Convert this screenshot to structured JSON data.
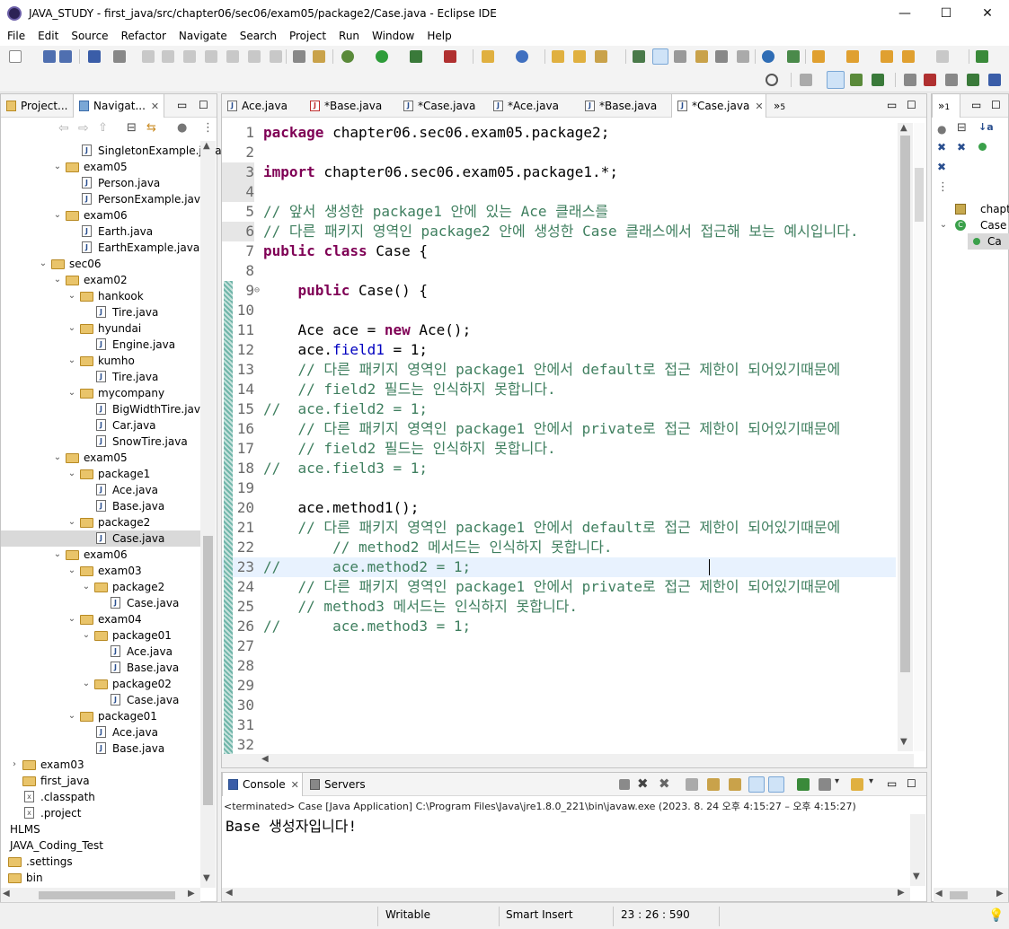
{
  "window": {
    "title": "JAVA_STUDY - first_java/src/chapter06/sec06/exam05/package2/Case.java - Eclipse IDE",
    "minimize": "—",
    "maximize": "☐",
    "close": "✕"
  },
  "menu": [
    "File",
    "Edit",
    "Source",
    "Refactor",
    "Navigate",
    "Search",
    "Project",
    "Run",
    "Window",
    "Help"
  ],
  "left_panel": {
    "tabs": [
      {
        "label": "Project..."
      },
      {
        "label": "Navigat..."
      }
    ],
    "tree": [
      {
        "type": "java",
        "label": "SingletonExample.java",
        "indent": 4
      },
      {
        "type": "folder",
        "label": "exam05",
        "indent": 3,
        "open": true
      },
      {
        "type": "java",
        "label": "Person.java",
        "indent": 4
      },
      {
        "type": "java",
        "label": "PersonExample.java",
        "indent": 4
      },
      {
        "type": "folder",
        "label": "exam06",
        "indent": 3,
        "open": true
      },
      {
        "type": "java",
        "label": "Earth.java",
        "indent": 4
      },
      {
        "type": "java",
        "label": "EarthExample.java",
        "indent": 4
      },
      {
        "type": "folder",
        "label": "sec06",
        "indent": 2,
        "open": true
      },
      {
        "type": "folder",
        "label": "exam02",
        "indent": 3,
        "open": true
      },
      {
        "type": "folder",
        "label": "hankook",
        "indent": 4,
        "open": true
      },
      {
        "type": "java",
        "label": "Tire.java",
        "indent": 5
      },
      {
        "type": "folder",
        "label": "hyundai",
        "indent": 4,
        "open": true
      },
      {
        "type": "java",
        "label": "Engine.java",
        "indent": 5
      },
      {
        "type": "folder",
        "label": "kumho",
        "indent": 4,
        "open": true
      },
      {
        "type": "java",
        "label": "Tire.java",
        "indent": 5
      },
      {
        "type": "folder",
        "label": "mycompany",
        "indent": 4,
        "open": true
      },
      {
        "type": "java",
        "label": "BigWidthTire.java",
        "indent": 5
      },
      {
        "type": "java",
        "label": "Car.java",
        "indent": 5
      },
      {
        "type": "java",
        "label": "SnowTire.java",
        "indent": 5
      },
      {
        "type": "folder",
        "label": "exam05",
        "indent": 3,
        "open": true
      },
      {
        "type": "folder",
        "label": "package1",
        "indent": 4,
        "open": true
      },
      {
        "type": "java",
        "label": "Ace.java",
        "indent": 5
      },
      {
        "type": "java",
        "label": "Base.java",
        "indent": 5
      },
      {
        "type": "folder",
        "label": "package2",
        "indent": 4,
        "open": true
      },
      {
        "type": "java",
        "label": "Case.java",
        "indent": 5,
        "selected": true
      },
      {
        "type": "folder",
        "label": "exam06",
        "indent": 3,
        "open": true
      },
      {
        "type": "folder",
        "label": "exam03",
        "indent": 4,
        "open": true
      },
      {
        "type": "folder",
        "label": "package2",
        "indent": 5,
        "open": true
      },
      {
        "type": "java",
        "label": "Case.java",
        "indent": 6
      },
      {
        "type": "folder",
        "label": "exam04",
        "indent": 4,
        "open": true
      },
      {
        "type": "folder",
        "label": "package01",
        "indent": 5,
        "open": true
      },
      {
        "type": "java",
        "label": "Ace.java",
        "indent": 6
      },
      {
        "type": "java",
        "label": "Base.java",
        "indent": 6
      },
      {
        "type": "folder",
        "label": "package02",
        "indent": 5,
        "open": true
      },
      {
        "type": "java",
        "label": "Case.java",
        "indent": 6
      },
      {
        "type": "folder",
        "label": "package01",
        "indent": 4,
        "open": true
      },
      {
        "type": "java",
        "label": "Ace.java",
        "indent": 5
      },
      {
        "type": "java",
        "label": "Base.java",
        "indent": 5
      },
      {
        "type": "folder",
        "label": "exam03",
        "indent": 0,
        "open": false
      },
      {
        "type": "folder",
        "label": "first_java",
        "indent": 0,
        "open": null
      },
      {
        "type": "xml",
        "label": ".classpath",
        "indent": 0
      },
      {
        "type": "xml",
        "label": ".project",
        "indent": 0
      },
      {
        "type": "project",
        "label": "HLMS",
        "indent": -1
      },
      {
        "type": "project",
        "label": "JAVA_Coding_Test",
        "indent": -1
      },
      {
        "type": "folder",
        "label": ".settings",
        "indent": -1,
        "open": null
      },
      {
        "type": "folder",
        "label": "bin",
        "indent": -1,
        "open": null
      }
    ]
  },
  "editor": {
    "tabs": [
      {
        "label": "Ace.java",
        "active": false,
        "error": false
      },
      {
        "label": "*Base.java",
        "active": false,
        "error": true
      },
      {
        "label": "*Case.java",
        "active": false,
        "error": false
      },
      {
        "label": "*Ace.java",
        "active": false,
        "error": false
      },
      {
        "label": "*Base.java",
        "active": false,
        "error": false
      },
      {
        "label": "*Case.java",
        "active": true,
        "error": false
      }
    ],
    "overflow_count": "5",
    "cursor_line": 23,
    "lines": [
      {
        "n": 1,
        "html": "<span class='kw'>package</span> chapter06.sec06.exam05.package2;"
      },
      {
        "n": 2,
        "html": ""
      },
      {
        "n": 3,
        "html": "<span class='kw'>import</span> chapter06.sec06.exam05.package1.*;"
      },
      {
        "n": 4,
        "html": ""
      },
      {
        "n": 5,
        "html": "<span class='cm'>// 앞서 생성한 package1 안에 있는 Ace 클래스를</span>"
      },
      {
        "n": 6,
        "html": "<span class='cm'>// 다른 패키지 영역인 package2 안에 생성한 Case 클래스에서 접근해 보는 예시입니다.</span>"
      },
      {
        "n": 7,
        "html": "<span class='kw'>public</span> <span class='kw'>class</span> Case {"
      },
      {
        "n": 8,
        "html": ""
      },
      {
        "n": 9,
        "html": "    <span class='kw'>public</span> Case() {"
      },
      {
        "n": 10,
        "html": ""
      },
      {
        "n": 11,
        "html": "    Ace ace = <span class='kw'>new</span> Ace();"
      },
      {
        "n": 12,
        "html": "    ace.<span class='fld'>field1</span> = 1;"
      },
      {
        "n": 13,
        "html": "    <span class='cm'>// 다른 패키지 영역인 package1 안에서 default로 접근 제한이 되어있기때문에</span>"
      },
      {
        "n": 14,
        "html": "    <span class='cm'>// field2 필드는 인식하지 못합니다.</span>"
      },
      {
        "n": 15,
        "html": "<span class='cm'>//  ace.field2 = 1;</span>"
      },
      {
        "n": 16,
        "html": "    <span class='cm'>// 다른 패키지 영역인 package1 안에서 private로 접근 제한이 되어있기때문에</span>"
      },
      {
        "n": 17,
        "html": "    <span class='cm'>// field2 필드는 인식하지 못합니다.</span>"
      },
      {
        "n": 18,
        "html": "<span class='cm'>//  ace.field3 = 1;</span>"
      },
      {
        "n": 19,
        "html": ""
      },
      {
        "n": 20,
        "html": "    ace.method1();"
      },
      {
        "n": 21,
        "html": "    <span class='cm'>// 다른 패키지 영역인 package1 안에서 default로 접근 제한이 되어있기때문에</span>"
      },
      {
        "n": 22,
        "html": "        <span class='cm'>// method2 메서드는 인식하지 못합니다.</span>"
      },
      {
        "n": 23,
        "html": "<span class='cm'>//      ace.method2 = 1;</span> "
      },
      {
        "n": 24,
        "html": "    <span class='cm'>// 다른 패키지 영역인 package1 안에서 private로 접근 제한이 되어있기때문에</span>"
      },
      {
        "n": 25,
        "html": "    <span class='cm'>// method3 메서드는 인식하지 못합니다.</span>"
      },
      {
        "n": 26,
        "html": "<span class='cm'>//      ace.method3 = 1;</span>"
      },
      {
        "n": 27,
        "html": ""
      },
      {
        "n": 28,
        "html": ""
      },
      {
        "n": 29,
        "html": ""
      },
      {
        "n": 30,
        "html": ""
      },
      {
        "n": 31,
        "html": ""
      },
      {
        "n": 32,
        "html": ""
      }
    ]
  },
  "right_panel": {
    "overflow_count": "1",
    "outline": [
      "chapt",
      "Case",
      "Ca"
    ]
  },
  "console": {
    "tabs": [
      {
        "label": "Console",
        "active": true
      },
      {
        "label": "Servers",
        "active": false
      }
    ],
    "status": "<terminated> Case [Java Application] C:\\Program Files\\Java\\jre1.8.0_221\\bin\\javaw.exe  (2023. 8. 24 오후 4:15:27 – 오후 4:15:27)",
    "output": "Base 생성자입니다!"
  },
  "statusbar": {
    "writable": "Writable",
    "insert_mode": "Smart Insert",
    "position": "23 : 26 : 590"
  }
}
